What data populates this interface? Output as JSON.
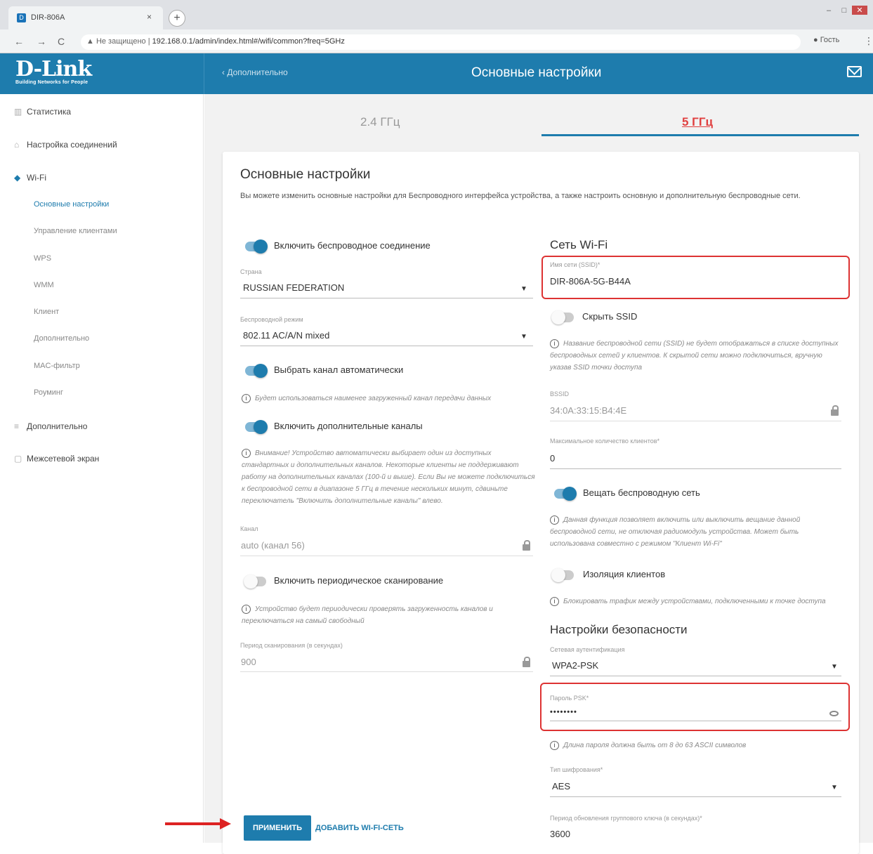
{
  "browser": {
    "tab_title": "DIR-806A",
    "tab_close": "×",
    "new_tab": "+",
    "not_secure": "▲ Не защищено",
    "url": "192.168.0.1/admin/index.html#/wifi/common?freq=5GHz",
    "guest": "Гость",
    "menu": "⋮",
    "back": "←",
    "forward": "→",
    "reload": "C"
  },
  "header": {
    "logo": "D-Link",
    "slogan": "Building Networks for People",
    "back_link": "‹ Дополнительно",
    "title": "Основные настройки"
  },
  "sidebar": {
    "items": [
      {
        "icon": "chart-icon",
        "label": "Статистика"
      },
      {
        "icon": "connections-icon",
        "label": "Настройка соединений"
      },
      {
        "icon": "wifi-icon",
        "label": "Wi-Fi"
      },
      {
        "icon": "sliders-icon",
        "label": "Дополнительно"
      },
      {
        "icon": "firewall-icon",
        "label": "Межсетевой экран"
      }
    ],
    "wifi_subitems": [
      "Основные настройки",
      "Управление клиентами",
      "WPS",
      "WMM",
      "Клиент",
      "Дополнительно",
      "MAC-фильтр",
      "Роуминг"
    ]
  },
  "tabs": {
    "band24": "2.4 ГГц",
    "band5": "5 ГГц"
  },
  "card": {
    "title": "Основные настройки",
    "description": "Вы можете изменить основные настройки для Беспроводного интерфейса устройства, а также настроить основную и дополнительную беспроводные сети."
  },
  "left": {
    "enable_wireless": "Включить беспроводное соединение",
    "country_label": "Страна",
    "country_value": "RUSSIAN FEDERATION",
    "mode_label": "Беспроводной режим",
    "mode_value": "802.11 AC/A/N mixed",
    "auto_channel": "Выбрать канал автоматически",
    "auto_channel_info": "Будет использоваться наименее загруженный канал передачи данных",
    "extra_channels": "Включить дополнительные каналы",
    "extra_channels_info": "Внимание! Устройство автоматически выбирает один из доступных стандартных и дополнительных каналов. Некоторые клиенты не поддерживают работу на дополнительных каналах (100-й и выше). Если Вы не можете подключиться к беспроводной сети в диапазоне 5 ГГц в течение нескольких минут, сдвиньте переключатель \"Включить дополнительные каналы\" влево.",
    "channel_label": "Канал",
    "channel_value": "auto (канал 56)",
    "periodic_scan": "Включить периодическое сканирование",
    "periodic_scan_info": "Устройство будет периодически проверять загруженность каналов и переключаться на самый свободный",
    "scan_period_label": "Период сканирования (в секундах)",
    "scan_period_value": "900"
  },
  "right": {
    "wifi_heading": "Сеть Wi-Fi",
    "ssid_label": "Имя сети (SSID)*",
    "ssid_value": "DIR-806A-5G-B44A",
    "hide_ssid": "Скрыть SSID",
    "hide_ssid_info": "Название беспроводной сети (SSID) не будет отображаться в списке доступных беспроводных сетей у клиентов. К скрытой сети можно подключиться, вручную указав SSID точки доступа",
    "bssid_label": "BSSID",
    "bssid_value": "34:0A:33:15:B4:4E",
    "max_clients_label": "Максимальное количество клиентов*",
    "max_clients_value": "0",
    "broadcast": "Вещать беспроводную сеть",
    "broadcast_info": "Данная функция позволяет включить или выключить вещание данной беспроводной сети, не отключая радиомодуль устройства. Может быть использована совместно с режимом \"Клиент Wi-Fi\"",
    "isolation": "Изоляция клиентов",
    "isolation_info": "Блокировать трафик между устройствами, подключенными к точке доступа",
    "security_heading": "Настройки безопасности",
    "auth_label": "Сетевая аутентификация",
    "auth_value": "WPA2-PSK",
    "psk_label": "Пароль PSK*",
    "psk_value": "••••••••",
    "psk_info": "Длина пароля должна быть от 8 до 63 ASCII символов",
    "encryption_label": "Тип шифрования*",
    "encryption_value": "AES",
    "gk_label": "Период обновления группового ключа (в секундах)*",
    "gk_value": "3600"
  },
  "buttons": {
    "apply": "ПРИМЕНИТЬ",
    "add_network": "ДОБАВИТЬ WI-FI-СЕТЬ"
  },
  "colors": {
    "brand": "#1e7cad",
    "highlight": "#dd3333"
  }
}
